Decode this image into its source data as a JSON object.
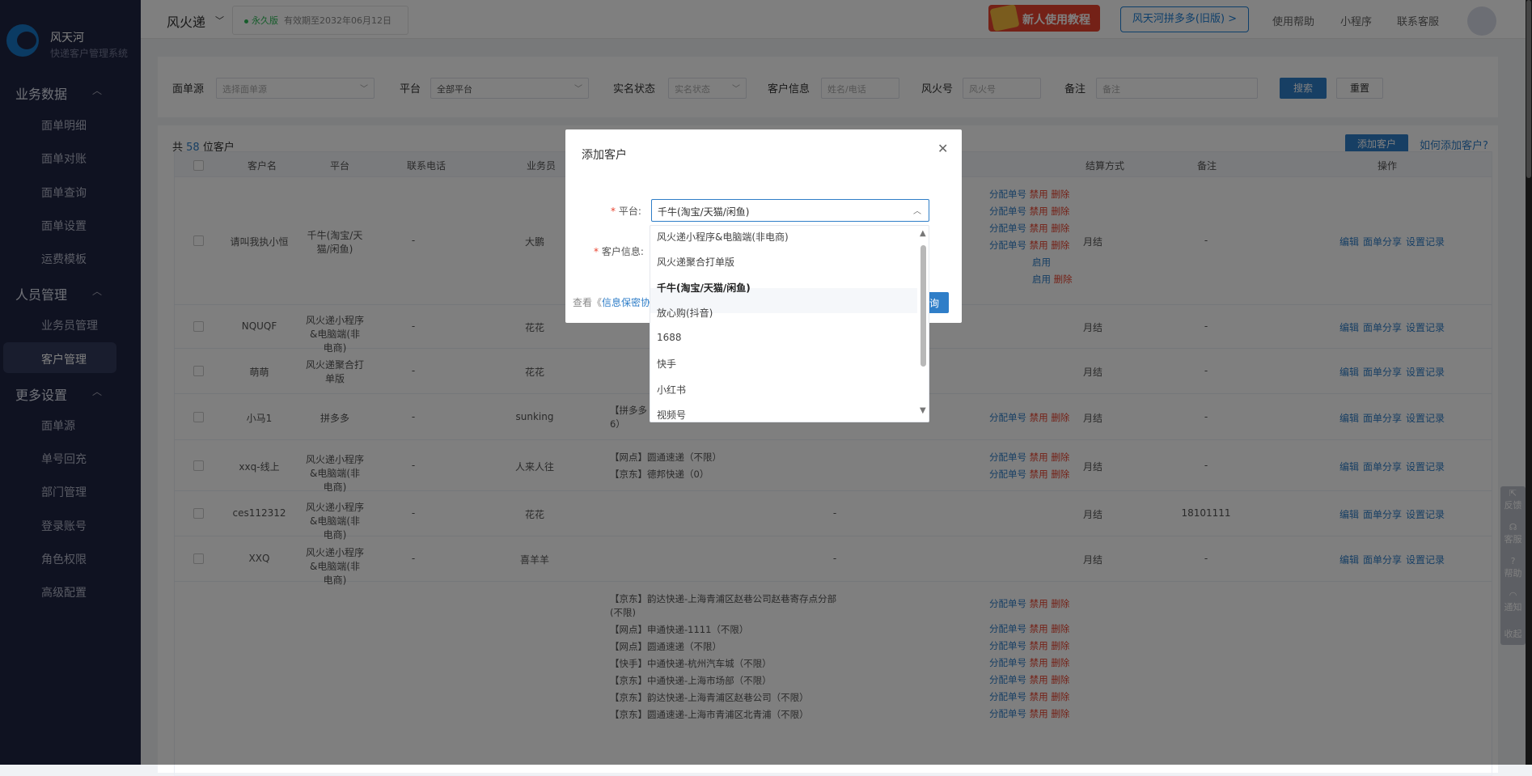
{
  "sidebar": {
    "brand": "风天河",
    "brand_sub": "快递客户管理系统",
    "groups": [
      {
        "label": "业务数据",
        "items": [
          "面单明细",
          "面单对账",
          "面单查询",
          "面单设置",
          "运费模板"
        ]
      },
      {
        "label": "人员管理",
        "items": [
          "业务员管理",
          "客户管理"
        ]
      },
      {
        "label": "更多设置",
        "items": [
          "面单源",
          "单号回充",
          "部门管理",
          "登录账号",
          "角色权限",
          "高级配置"
        ]
      }
    ],
    "active": "客户管理"
  },
  "topbar": {
    "app": "风火递",
    "license_version": "永久版",
    "license_expiry": "有效期至2032年06月12日",
    "tutorial": "新人使用教程",
    "old_link": "风天河拼多多(旧版) >",
    "links": [
      "使用帮助",
      "小程序",
      "联系客服"
    ]
  },
  "filter": {
    "label_source": "面单源",
    "ph_source": "选择面单源",
    "label_platform": "平台",
    "val_platform": "全部平台",
    "label_realname": "实名状态",
    "ph_realname": "实名状态",
    "label_customer": "客户信息",
    "ph_customer": "姓名/电话",
    "label_fh": "风火号",
    "ph_fh": "风火号",
    "label_remark": "备注",
    "ph_remark": "备注",
    "search": "搜索",
    "reset": "重置"
  },
  "list": {
    "count_prefix": "共",
    "count": "58",
    "count_suffix": "位客户",
    "add_btn": "添加客户",
    "howto": "如何添加客户?",
    "headers": [
      "客户名",
      "平台",
      "联系电话",
      "业务员",
      "结算方式",
      "备注",
      "操作"
    ],
    "ops": [
      "编辑",
      "面单分享",
      "设置记录"
    ],
    "action_labels": {
      "assign": "分配单号",
      "disable": "禁用",
      "enable": "启用",
      "delete": "删除"
    },
    "rows": [
      {
        "name": "请叫我执小恒",
        "platform": "千牛(淘宝/天猫/闲鱼)",
        "phone": "-",
        "sales": "大鹏",
        "settle": "月结",
        "remark": "-"
      },
      {
        "name": "NQUQF",
        "platform": "风火递小程序&电脑端(非电商)",
        "phone": "-",
        "sales": "花花",
        "settle": "月结",
        "remark": "-"
      },
      {
        "name": "萌萌",
        "platform": "风火递聚合打单版",
        "phone": "-",
        "sales": "花花",
        "settle": "月结",
        "remark": "-"
      },
      {
        "name": "小马1",
        "platform": "拼多多",
        "phone": "-",
        "sales": "sunking",
        "settle": "月结",
        "remark": "-",
        "express": [
          "【拼多多（无店铺）】圆通速递-浙江省杭州市临平（6",
          "6）"
        ]
      },
      {
        "name": "xxq-线上",
        "platform": "风火递小程序&电脑端(非电商)",
        "phone": "-",
        "sales": "人来人往",
        "settle": "月结",
        "remark": "-",
        "express": [
          "【网点】圆通速递（不限）",
          "【京东】德邦快递（0）"
        ]
      },
      {
        "name": "ces112312",
        "platform": "风火递小程序&电脑端(非电商)",
        "phone": "-",
        "sales": "花花",
        "settle": "月结",
        "remark": "18101111",
        "express_dash": "-"
      },
      {
        "name": "XXQ",
        "platform": "风火递小程序&电脑端(非电商)",
        "phone": "-",
        "sales": "喜羊羊",
        "settle": "月结",
        "remark": "-",
        "express_dash": "-"
      }
    ],
    "last_express": [
      "【京东】韵达快递-上海青浦区赵巷公司赵巷寄存点分部",
      "(不限)",
      "【网点】申通快递-1111（不限）",
      "【网点】圆通速递（不限）",
      "【快手】中通快递-杭州汽车城（不限）",
      "【京东】中通快递-上海市场部（不限）",
      "【京东】韵达快递-上海青浦区赵巷公司（不限）",
      "【京东】圆通速递-上海市青浦区北青浦（不限）"
    ]
  },
  "modal": {
    "title": "添加客户",
    "label_platform": "平台:",
    "label_customer": "客户信息:",
    "platform_value": "千牛(淘宝/天猫/闲鱼)",
    "agree_prefix": "查看《",
    "agree_link": "信息保密协",
    "btn": "询",
    "options": [
      "风火递小程序&电脑端(非电商)",
      "风火递聚合打单版",
      "千牛(淘宝/天猫/闲鱼)",
      "放心购(抖音)",
      "1688",
      "快手",
      "小红书",
      "视频号"
    ],
    "selected_index": 2
  },
  "side_tools": [
    "反馈",
    "客服",
    "帮助",
    "通知",
    "收起"
  ]
}
